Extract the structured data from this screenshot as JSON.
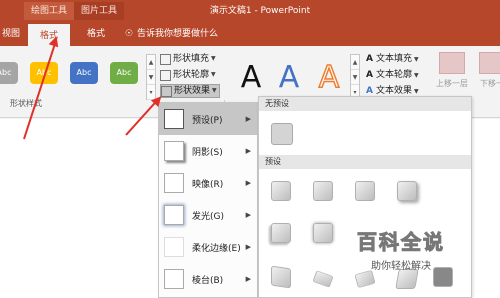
{
  "titlebar": {
    "context_tab_drawing": "绘图工具",
    "context_tab_picture": "图片工具",
    "document_title": "演示文稿1 - PowerPoint",
    "background_color": "#b7472a"
  },
  "tabs": {
    "view": "视图",
    "format_drawing": "格式",
    "format_picture": "格式",
    "tell_me": "告诉我你想要做什么"
  },
  "ribbon": {
    "shape_style_swatches": [
      "Abc",
      "Abc",
      "Abc",
      "Abc"
    ],
    "shape_fill": "形状填充",
    "shape_outline": "形状轮廓",
    "shape_effects": "形状效果",
    "wordart_samples": [
      "A",
      "A",
      "A"
    ],
    "text_fill": "文本填充",
    "text_outline": "文本轮廓",
    "text_effects": "文本效果",
    "bring_forward": "上移一层",
    "send_backward": "下移一",
    "group_label": "形状样式"
  },
  "effects_menu": {
    "items": [
      {
        "label": "预设(P)",
        "icon": "preset-icon"
      },
      {
        "label": "阴影(S)",
        "icon": "shadow-icon"
      },
      {
        "label": "映像(R)",
        "icon": "reflection-icon"
      },
      {
        "label": "发光(G)",
        "icon": "glow-icon"
      },
      {
        "label": "柔化边缘(E)",
        "icon": "soft-edges-icon"
      },
      {
        "label": "棱台(B)",
        "icon": "bevel-icon"
      }
    ]
  },
  "preset_submenu": {
    "no_preset_header": "无预设",
    "preset_header": "预设"
  },
  "watermark": {
    "title": "百科全说",
    "subtitle": "助你轻松解决"
  }
}
